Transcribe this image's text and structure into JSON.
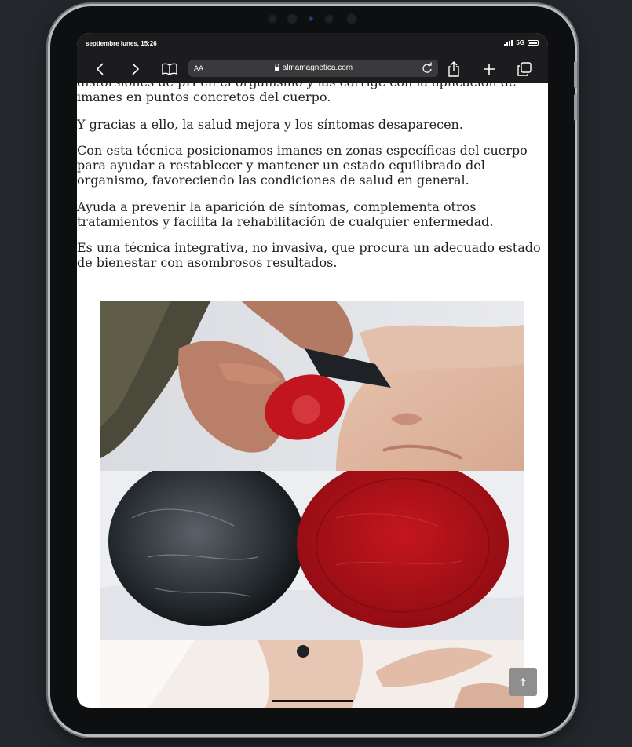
{
  "status_bar": {
    "time": "septiembre lunes, 15:26",
    "network": "5G"
  },
  "browser": {
    "reader_label": "AA",
    "url": "almamagnetica.com"
  },
  "article": {
    "paragraphs": [
      "distorsiones de pH en el organismo y las corrige con la aplicación de imanes en puntos concretos del cuerpo.",
      "Y gracias a ello, la salud mejora y los síntomas desaparecen.",
      "Con esta técnica posicionamos imanes en zonas específicas del cuerpo para ayudar a restablecer y mantener un estado equilibrado del organismo, favoreciendo las condiciones de salud en general.",
      "Ayuda a prevenir la aparición de síntomas, complementa otros tratamientos y facilita la rehabilitación de cualquier enfermedad.",
      "Es una técnica integrativa, no invasiva, que procura un adecuado estado de bienestar con asombrosos resultados."
    ]
  },
  "scroll_top_icon": "arrow-up-icon",
  "colors": {
    "page_bg": "#23272b",
    "toolbar_bg": "#1c1c1e",
    "magnet_red": "#b5141b",
    "magnet_black": "#1d2226"
  }
}
